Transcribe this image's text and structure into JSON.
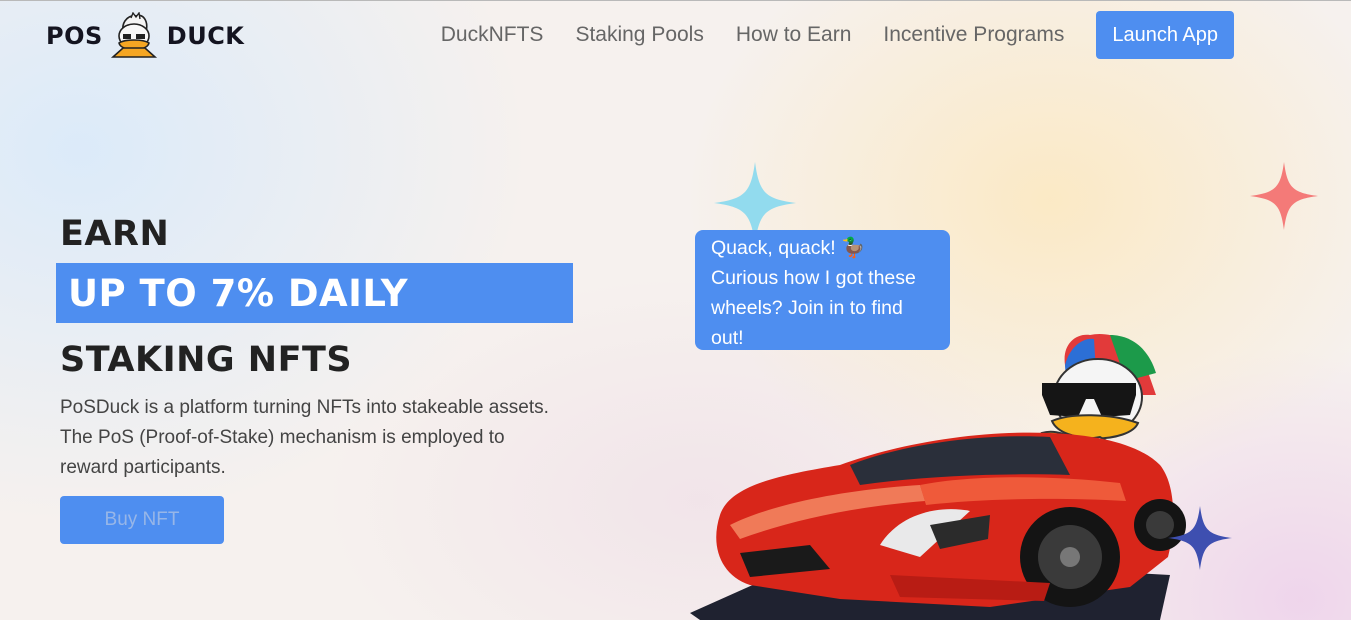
{
  "header": {
    "logo_left": "POS",
    "logo_right": "DUCK",
    "nav": [
      {
        "label": "DuckNFTS"
      },
      {
        "label": "Staking Pools"
      },
      {
        "label": "How to Earn"
      },
      {
        "label": "Incentive Programs"
      }
    ],
    "launch_label": "Launch App"
  },
  "hero": {
    "line1": "EARN",
    "highlight": "UP TO 7% DAILY",
    "line3": "STAKING NFTS",
    "description": "PoSDuck is a platform turning NFTs into stakeable assets. The PoS (Proof-of-Stake) mechanism is employed to reward participants.",
    "cta_label": "Buy NFT"
  },
  "bubble": {
    "text": "Quack, quack! 🦆 Curious how I got these wheels? Join in to find out!"
  },
  "colors": {
    "accent": "#4e8ef0",
    "car": "#d8261a",
    "sparkle_cyan": "#86d8ee",
    "sparkle_red": "#f36d6d",
    "sparkle_navy": "#3e4fb0"
  }
}
